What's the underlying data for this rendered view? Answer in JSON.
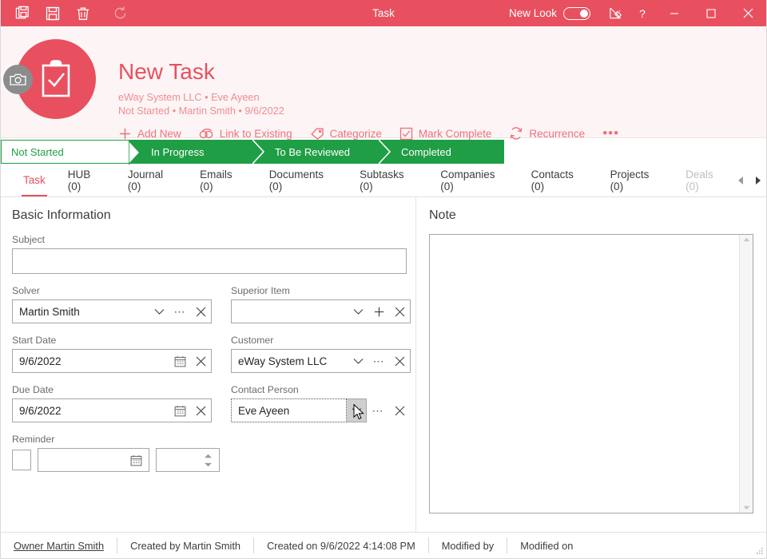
{
  "titlebar": {
    "title": "Task",
    "tools": [
      {
        "name": "save-copy-icon",
        "label": "Save and New"
      },
      {
        "name": "save-icon",
        "label": "Save"
      },
      {
        "name": "delete-icon",
        "label": "Delete"
      },
      {
        "name": "refresh-icon",
        "label": "Refresh"
      }
    ],
    "new_look_label": "New Look",
    "toggle_state": "on",
    "design_icon": "ruler-icon",
    "help_label": "?",
    "minimize_label": "─",
    "maximize_label": "□",
    "close_label": "✕"
  },
  "header": {
    "avatar_icon": "clipboard-check-icon",
    "camera_icon": "camera-icon",
    "title": "New Task",
    "meta_line1": "eWay System LLC • Eve Ayeen",
    "meta_line2": "Not Started • Martin Smith • 9/6/2022",
    "actions": [
      {
        "icon": "plus-icon",
        "label": "Add New"
      },
      {
        "icon": "link-icon",
        "label": "Link to Existing"
      },
      {
        "icon": "tag-icon",
        "label": "Categorize"
      },
      {
        "icon": "checkbox-icon",
        "label": "Mark Complete"
      },
      {
        "icon": "recurrence-icon",
        "label": "Recurrence"
      }
    ],
    "more_label": "•••"
  },
  "status_steps": [
    {
      "label": "Not Started",
      "state": "current"
    },
    {
      "label": "In Progress",
      "state": "upcoming"
    },
    {
      "label": "To Be Reviewed",
      "state": "upcoming"
    },
    {
      "label": "Completed",
      "state": "upcoming"
    }
  ],
  "tabs": [
    {
      "label": "Task",
      "active": true
    },
    {
      "label": "HUB (0)",
      "active": false
    },
    {
      "label": "Journal (0)",
      "active": false
    },
    {
      "label": "Emails (0)",
      "active": false
    },
    {
      "label": "Documents (0)",
      "active": false
    },
    {
      "label": "Subtasks (0)",
      "active": false
    },
    {
      "label": "Companies (0)",
      "active": false
    },
    {
      "label": "Contacts (0)",
      "active": false
    },
    {
      "label": "Projects (0)",
      "active": false
    },
    {
      "label": "Deals (0)",
      "active": false,
      "faded": true
    }
  ],
  "tab_nav": {
    "prev": "◀",
    "next": "▶"
  },
  "form": {
    "section_title": "Basic Information",
    "subject": {
      "label": "Subject",
      "value": "",
      "placeholder": ""
    },
    "solver": {
      "label": "Solver",
      "value": "Martin Smith"
    },
    "superior_item": {
      "label": "Superior Item",
      "value": ""
    },
    "start_date": {
      "label": "Start Date",
      "value": "9/6/2022"
    },
    "customer": {
      "label": "Customer",
      "value": "eWay System LLC"
    },
    "due_date": {
      "label": "Due Date",
      "value": "9/6/2022"
    },
    "contact_person": {
      "label": "Contact Person",
      "value": "Eve Ayeen",
      "focused": true
    },
    "reminder": {
      "label": "Reminder",
      "checked": false,
      "date_value": "",
      "time_value": ""
    }
  },
  "note": {
    "title": "Note",
    "value": "",
    "scroll_up": "▲",
    "scroll_down": "▼"
  },
  "footer": {
    "owner": "Owner Martin Smith",
    "created_by": "Created by Martin Smith",
    "created_on": "Created on 9/6/2022 4:14:08 PM",
    "modified_by": "Modified by",
    "modified_on": "Modified on"
  },
  "colors": {
    "accent_red": "#e8505f",
    "header_bg": "#fdf5f5",
    "status_green": "#1f9e45",
    "meta_pink": "#ef8c94"
  }
}
